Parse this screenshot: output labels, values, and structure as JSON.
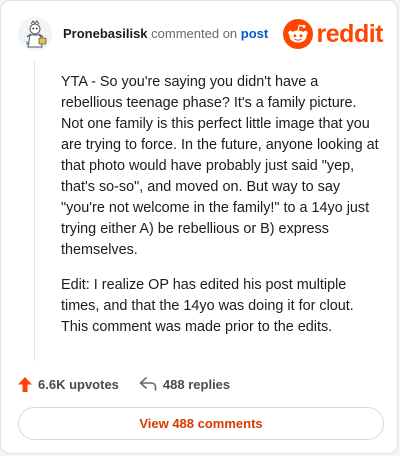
{
  "header": {
    "username": "Pronebasilisk",
    "action_text": "commented on",
    "post_link_text": "post",
    "logo_icon": "reddit-snoo-icon",
    "logo_text": "reddit"
  },
  "comment": {
    "paragraphs": [
      "YTA - So you're saying you didn't have a rebellious teenage phase? It's a family picture. Not one family is this perfect little image that you are trying to force. In the future, anyone looking at that photo would have probably just said \"yep, that's so-so\", and moved on. But way to say \"you're not welcome in the family!\" to a 14yo just trying either A) be rebellious or B) express themselves.",
      "Edit: I realize OP has edited his post multiple times, and that the 14yo was doing it for clout. This comment was made prior to the edits."
    ]
  },
  "stats": {
    "upvotes": "6.6K upvotes",
    "replies": "488 replies",
    "upvote_icon": "upvote-arrow-icon",
    "reply_icon": "reply-arrow-icon"
  },
  "actions": {
    "view_comments": "View 488 comments"
  },
  "colors": {
    "brand": "#ff4500",
    "link": "#0a58ca",
    "button_text": "#d93a00"
  }
}
